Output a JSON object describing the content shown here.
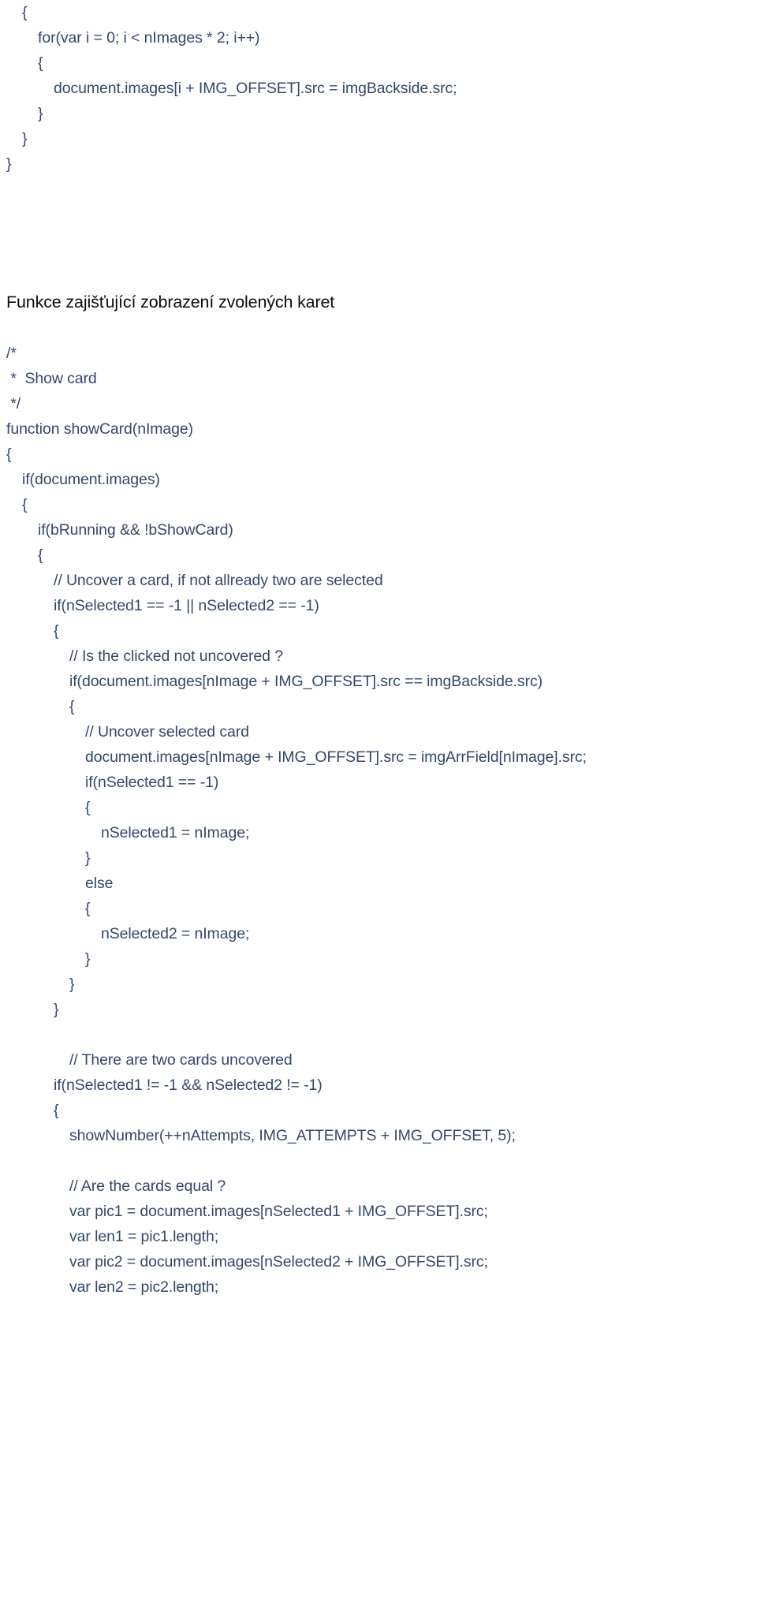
{
  "document": {
    "page_background": "#ffffff",
    "code_color": "#33486a",
    "heading_color": "#0d0d0d",
    "heading": "Funkce zajišťující zobrazení zvolených karet"
  },
  "code_top": [
    {
      "indent": 1,
      "text": "{"
    },
    {
      "indent": 2,
      "text": "for(var i = 0; i < nImages * 2; i++)"
    },
    {
      "indent": 2,
      "text": "{"
    },
    {
      "indent": 3,
      "text": "document.images[i + IMG_OFFSET].src = imgBackside.src;"
    },
    {
      "indent": 2,
      "text": "}"
    },
    {
      "indent": 1,
      "text": "}"
    },
    {
      "indent": 0,
      "text": "}"
    }
  ],
  "code_bottom": [
    {
      "indent": 0,
      "text": "/*"
    },
    {
      "indent": 0,
      "text": " *  Show card"
    },
    {
      "indent": 0,
      "text": " */"
    },
    {
      "indent": 0,
      "text": "function showCard(nImage)"
    },
    {
      "indent": 0,
      "text": "{"
    },
    {
      "indent": 1,
      "text": "if(document.images)"
    },
    {
      "indent": 1,
      "text": "{"
    },
    {
      "indent": 2,
      "text": "if(bRunning && !bShowCard)"
    },
    {
      "indent": 2,
      "text": "{"
    },
    {
      "indent": 3,
      "text": "// Uncover a card, if not allready two are selected"
    },
    {
      "indent": 3,
      "text": "if(nSelected1 == -1 || nSelected2 == -1)"
    },
    {
      "indent": 3,
      "text": "{"
    },
    {
      "indent": 4,
      "text": "// Is the clicked not uncovered ?"
    },
    {
      "indent": 4,
      "text": "if(document.images[nImage + IMG_OFFSET].src == imgBackside.src)"
    },
    {
      "indent": 4,
      "text": "{"
    },
    {
      "indent": 5,
      "text": "// Uncover selected card"
    },
    {
      "indent": 5,
      "text": "document.images[nImage + IMG_OFFSET].src = imgArrField[nImage].src;"
    },
    {
      "indent": 5,
      "text": "if(nSelected1 == -1)"
    },
    {
      "indent": 5,
      "text": "{"
    },
    {
      "indent": 6,
      "text": "nSelected1 = nImage;"
    },
    {
      "indent": 5,
      "text": "}"
    },
    {
      "indent": 5,
      "text": "else"
    },
    {
      "indent": 5,
      "text": "{"
    },
    {
      "indent": 6,
      "text": "nSelected2 = nImage;"
    },
    {
      "indent": 5,
      "text": "}"
    },
    {
      "indent": 4,
      "text": "}"
    },
    {
      "indent": 3,
      "text": "}"
    },
    {
      "indent": 0,
      "text": ""
    },
    {
      "indent": 4,
      "text": "// There are two cards uncovered"
    },
    {
      "indent": 3,
      "text": "if(nSelected1 != -1 && nSelected2 != -1)"
    },
    {
      "indent": 3,
      "text": "{"
    },
    {
      "indent": 4,
      "text": "showNumber(++nAttempts, IMG_ATTEMPTS + IMG_OFFSET, 5);"
    },
    {
      "indent": 0,
      "text": ""
    },
    {
      "indent": 4,
      "text": "// Are the cards equal ?"
    },
    {
      "indent": 4,
      "text": "var pic1 = document.images[nSelected1 + IMG_OFFSET].src;"
    },
    {
      "indent": 4,
      "text": "var len1 = pic1.length;"
    },
    {
      "indent": 4,
      "text": "var pic2 = document.images[nSelected2 + IMG_OFFSET].src;"
    },
    {
      "indent": 4,
      "text": "var len2 = pic2.length;"
    }
  ]
}
